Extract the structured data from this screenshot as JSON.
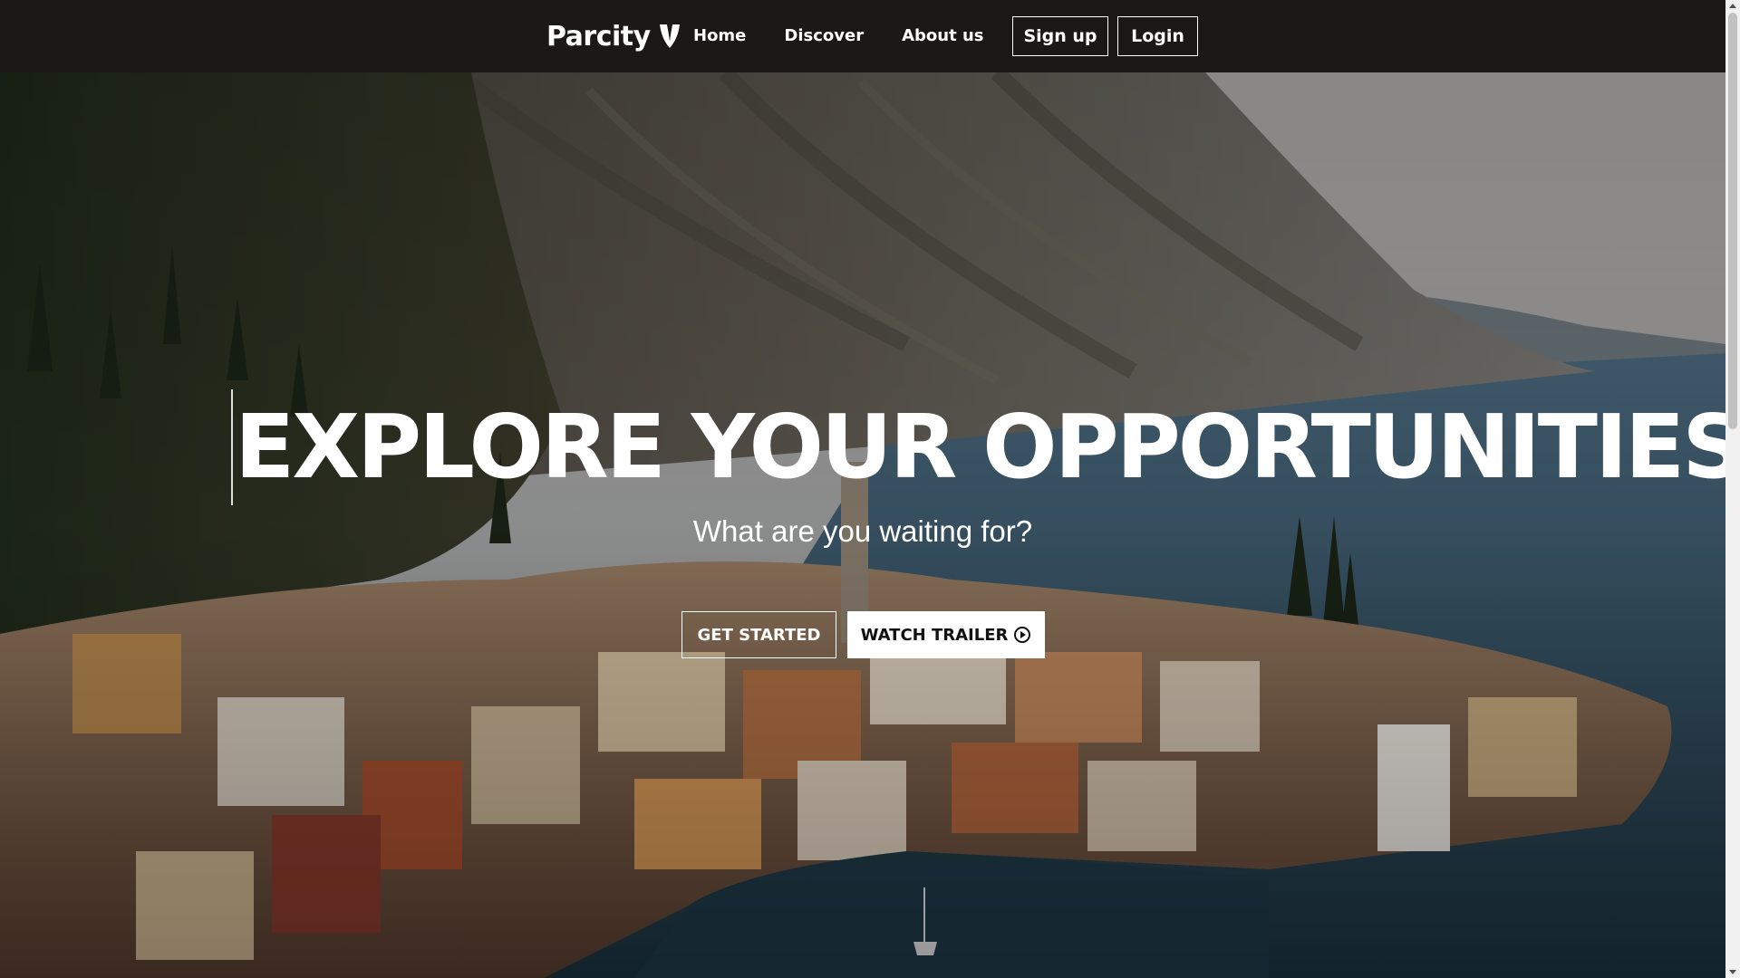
{
  "brand": {
    "name": "Parcity",
    "logo_icon": "v-shield-logo-icon"
  },
  "nav": {
    "items": [
      {
        "label": "Home"
      },
      {
        "label": "Discover"
      },
      {
        "label": "About us"
      }
    ]
  },
  "auth": {
    "signup_label": "Sign up",
    "login_label": "Login"
  },
  "hero": {
    "title": "EXPLORE YOUR OPPORTUNITIES",
    "subtitle": "What are you waiting for?",
    "get_started_label": "GET STARTED",
    "watch_trailer_label": "WATCH TRAILER",
    "watch_trailer_icon": "play-circle-icon",
    "background": "aerial photo of lakeside town beneath mountains"
  },
  "colors": {
    "navbar_bg": "#1b1918",
    "text": "#ffffff",
    "button_light_bg": "#ffffff",
    "button_dark_text": "#111111"
  }
}
